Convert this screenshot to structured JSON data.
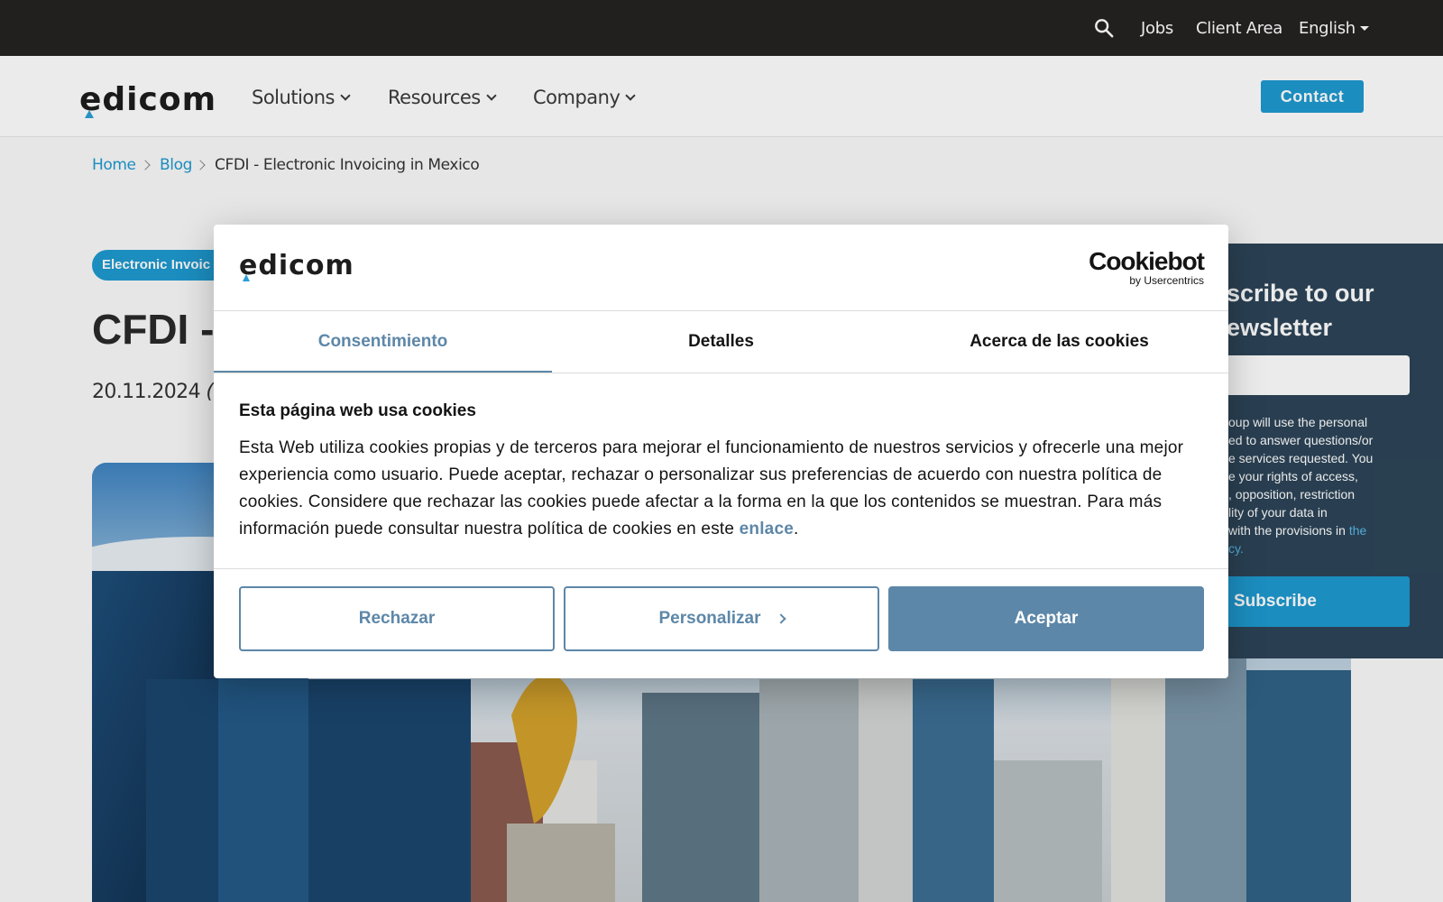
{
  "topbar": {
    "jobs": "Jobs",
    "client_area": "Client Area",
    "language": "English"
  },
  "nav": {
    "logo": "edicom",
    "solutions": "Solutions",
    "resources": "Resources",
    "company": "Company",
    "contact": "Contact"
  },
  "breadcrumb": {
    "home": "Home",
    "blog": "Blog",
    "current": "CFDI - Electronic Invoicing in Mexico"
  },
  "article": {
    "tag": "Electronic Invoic",
    "title": "CFDI -",
    "date": "20.11.2024",
    "date_suffix": "(U"
  },
  "newsletter": {
    "title_line1": "scribe to our",
    "title_line2": "ewsletter",
    "text_lines": [
      "oup will use the personal",
      "ed to answer questions/or",
      "e services requested. You",
      "e your rights of access,",
      ", opposition, restriction",
      "lity of your data in",
      " with the provisions in "
    ],
    "link_part1": "the",
    "link_part2": "cy.",
    "subscribe": "Subscribe"
  },
  "cookie_dialog": {
    "logo": "edicom",
    "provider": "Cookiebot",
    "provider_sub": "by Usercentrics",
    "tabs": [
      "Consentimiento",
      "Detalles",
      "Acerca de las cookies"
    ],
    "heading": "Esta página web usa cookies",
    "body": "Esta Web utiliza cookies propias y de terceros para mejorar el funcionamiento de nuestros servicios y ofrecerle una mejor experiencia como usuario. Puede aceptar, rechazar o personalizar sus preferencias de acuerdo con nuestra política de cookies. Considere que rechazar las cookies puede afectar a la forma en la que los contenidos se muestran. Para más información puede consultar nuestra política de cookies en este ",
    "link": "enlace",
    "period": ".",
    "reject": "Rechazar",
    "customize": "Personalizar",
    "accept": "Aceptar"
  },
  "colors": {
    "brand_blue": "#1e9ad0",
    "dialog_accent": "#5d87a8",
    "topbar_bg": "#252222",
    "newsletter_bg": "#2d4558"
  }
}
